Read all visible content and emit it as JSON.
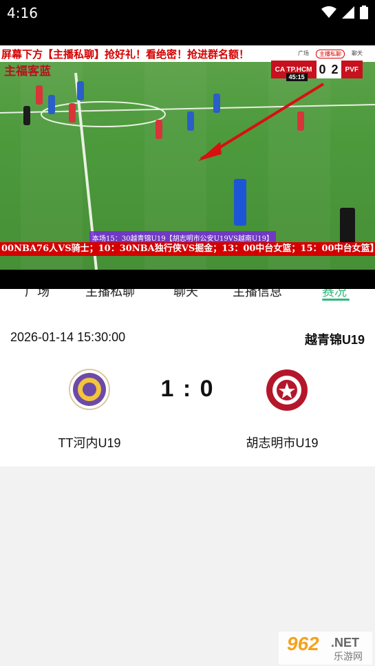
{
  "status_bar": {
    "time": "4:16"
  },
  "video": {
    "top_marquee": "屏幕下方【主播私聊】抢好礼！看绝密！抢进群名额！",
    "mini_tabs": [
      "广场",
      "主播私聊",
      "聊天"
    ],
    "logo_text": "主福客蓝",
    "scoreboard": {
      "home": "CA TP.HCM",
      "home_score": "0",
      "away_score": "2",
      "away": "PVF",
      "clock": "45:15"
    },
    "subtitle": "本场15：30越青锦U19【胡志明市公安U19VS越南U19】",
    "bottom_marquee": "00NBA76人VS骑士；10：30NBA独行侠VS掘金；13：00中台女篮；15：00中台女篮】"
  },
  "tabs": [
    {
      "label": "广场"
    },
    {
      "label": "主播私聊"
    },
    {
      "label": "聊天"
    },
    {
      "label": "主播信息"
    },
    {
      "label": "赛况"
    }
  ],
  "match": {
    "datetime": "2026-01-14 15:30:00",
    "league": "越青锦U19",
    "score": "1 : 0",
    "home_name": "TT河内U19",
    "away_name": "胡志明市U19"
  },
  "watermark": {
    "brand": "962",
    "suffix": ".NET",
    "site": "乐游网"
  },
  "colors": {
    "accent": "#2db87a",
    "marquee_red": "#d40000"
  }
}
